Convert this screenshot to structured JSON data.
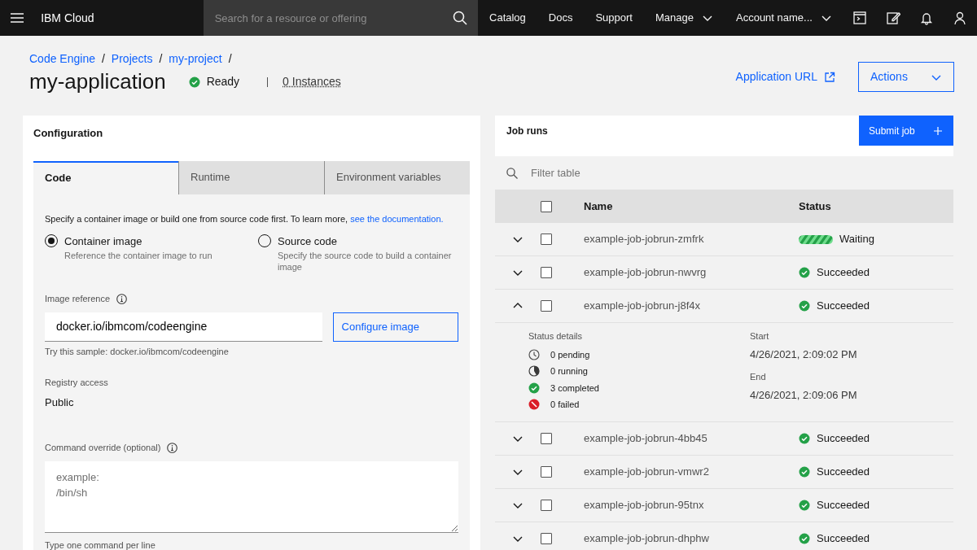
{
  "header": {
    "brand": "IBM Cloud",
    "search": {
      "placeholder": "Search for a resource or offering"
    },
    "nav": [
      {
        "label": "Catalog",
        "kind": "link"
      },
      {
        "label": "Docs",
        "kind": "link"
      },
      {
        "label": "Support",
        "kind": "link"
      },
      {
        "label": "Manage",
        "kind": "dropdown"
      },
      {
        "label": "Account name...",
        "kind": "dropdown"
      }
    ]
  },
  "breadcrumbs": [
    {
      "label": "Code Engine",
      "separator": "/"
    },
    {
      "label": "Projects",
      "separator": "/"
    },
    {
      "label": "my-project",
      "separator": "/"
    }
  ],
  "page": {
    "title": "my-application",
    "status": {
      "label": "Ready",
      "kind": "success"
    },
    "instances": "0 Instances",
    "application_url": "Application URL",
    "actions": "Actions"
  },
  "configuration": {
    "title": "Configuration",
    "tabs": [
      {
        "label": "Code",
        "selected": true
      },
      {
        "label": "Runtime",
        "selected": false
      },
      {
        "label": "Environment variables",
        "selected": false
      }
    ],
    "intro": "Specify a container image or build one from source code first. To learn more, ",
    "intro_link": "see the documentation.",
    "radios": [
      {
        "label": "Container image",
        "description": "Reference the container image to run",
        "selected": true
      },
      {
        "label": "Source code",
        "description": "Specify the source code to build a container image",
        "selected": false
      }
    ],
    "image_reference": {
      "label": "Image reference",
      "value": "docker.io/ibmcom/codeengine",
      "hint": "Try this sample: docker.io/ibmcom/codeengine"
    },
    "configure_button": "Configure image",
    "registry_access": {
      "label": "Registry access",
      "value": "Public"
    },
    "command_override": {
      "label": "Command override (optional)",
      "placeholder": "example:\n/bin/sh",
      "hint": "Type one command per line"
    }
  },
  "job_runs": {
    "title": "Job runs",
    "submit_button": "Submit job",
    "filter": {
      "placeholder": "Filter table"
    },
    "columns": [
      "Name",
      "Status"
    ],
    "select_all_checked": false,
    "rows": [
      {
        "name": "example-job-jobrun-zmfrk",
        "status": "Waiting",
        "kind": "waiting",
        "expanded": false,
        "checked": false
      },
      {
        "name": "example-job-jobrun-nwvrg",
        "status": "Succeeded",
        "kind": "success",
        "expanded": false,
        "checked": false
      },
      {
        "name": "example-job-jobrun-j8f4x",
        "status": "Succeeded",
        "kind": "success",
        "expanded": true,
        "checked": false,
        "details": {
          "label": "Status details",
          "counts": [
            {
              "kind": "pending",
              "text": "0 pending"
            },
            {
              "kind": "running",
              "text": "0 running"
            },
            {
              "kind": "completed",
              "text": "3 completed"
            },
            {
              "kind": "failed",
              "text": "0 failed"
            }
          ],
          "start_label": "Start",
          "start": "4/26/2021, 2:09:02 PM",
          "end_label": "End",
          "end": "4/26/2021, 2:09:06 PM"
        }
      },
      {
        "name": "example-job-jobrun-4bb45",
        "status": "Succeeded",
        "kind": "success",
        "expanded": false,
        "checked": false
      },
      {
        "name": "example-job-jobrun-vmwr2",
        "status": "Succeeded",
        "kind": "success",
        "expanded": false,
        "checked": false
      },
      {
        "name": "example-job-jobrun-95tnx",
        "status": "Succeeded",
        "kind": "success",
        "expanded": false,
        "checked": false
      },
      {
        "name": "example-job-jobrun-dhphw",
        "status": "Succeeded",
        "kind": "success",
        "expanded": false,
        "checked": false
      }
    ]
  }
}
